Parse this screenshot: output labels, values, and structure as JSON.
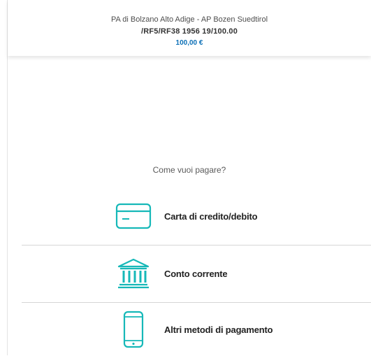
{
  "header": {
    "payee": "PA di Bolzano Alto Adige - AP Bozen Suedtirol",
    "reference": "/RF5/RF38 1956 19/100.00",
    "amount": "100,00 €"
  },
  "prompt": "Come vuoi pagare?",
  "methods": [
    {
      "label": "Carta di credito/debito",
      "icon": "credit-card-icon"
    },
    {
      "label": "Conto corrente",
      "icon": "bank-icon"
    },
    {
      "label": "Altri metodi di pagamento",
      "icon": "smartphone-icon"
    }
  ],
  "colors": {
    "accent": "#16b8b8",
    "amount": "#0b6fb6"
  }
}
